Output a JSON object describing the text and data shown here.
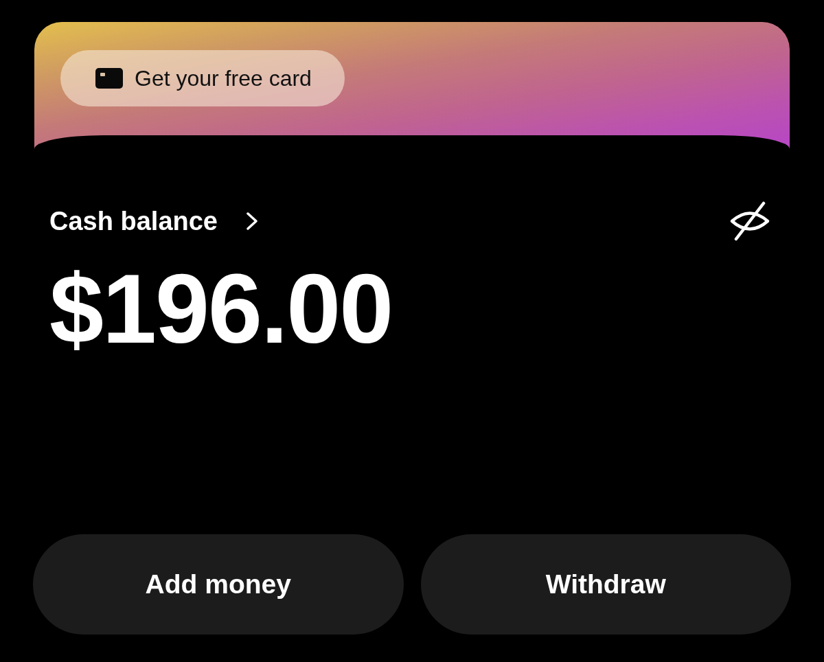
{
  "promo_button": {
    "label": "Get your free card"
  },
  "balance": {
    "label": "Cash balance",
    "amount": "$196.00"
  },
  "actions": [
    {
      "label": "Add money"
    },
    {
      "label": "Withdraw"
    }
  ]
}
